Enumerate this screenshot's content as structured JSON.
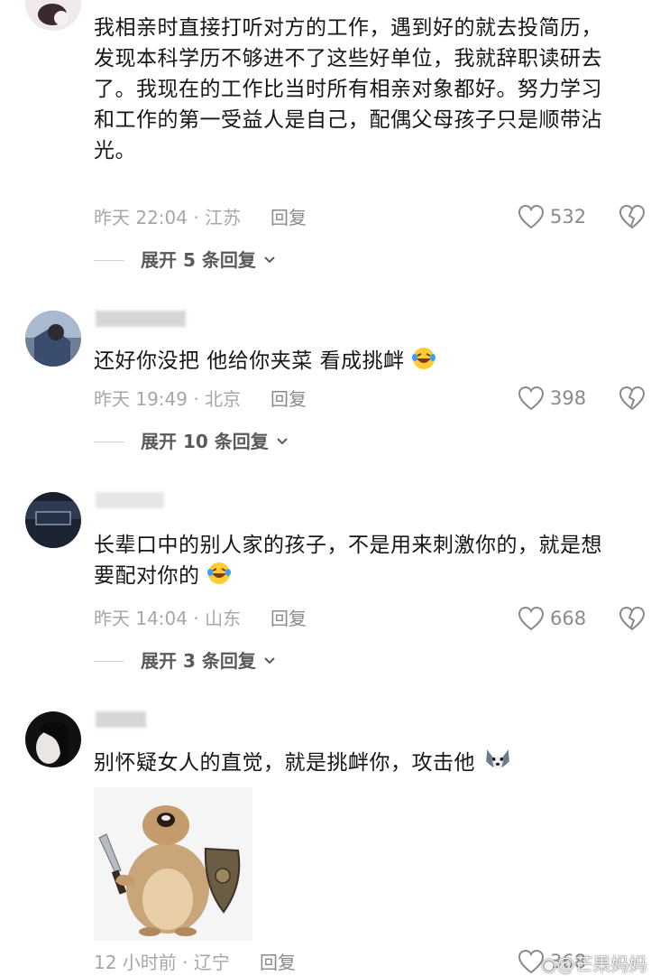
{
  "comments": [
    {
      "text": "我相亲时直接打听对方的工作，遇到好的就去投简历，发现本科学历不够进不了这些好单位，我就辞职读研去了。我现在的工作比当时所有相亲对象都好。努力学习和工作的第一受益人是自己，配偶父母孩子只是顺带沾光。",
      "lines": [
        "我相亲时直接打听对方的工作，遇到好的就去投简历，",
        "发现本科学历不够进不了这些好单位，我就辞职读研去",
        "了。我现在的工作比当时所有相亲对象都好。努力学习",
        "和工作的第一受益人是自己，配偶父母孩子只是顺带沾",
        "光。"
      ],
      "time_location": "昨天 22:04 · 江苏",
      "reply_label": "回复",
      "likes": "532",
      "expand_label": "展开 5 条回复"
    },
    {
      "text": "还好你没把 他给你夹菜 看成挑衅",
      "emoji": "laugh-cry-emoji",
      "time_location": "昨天 19:49 · 北京",
      "reply_label": "回复",
      "likes": "398",
      "expand_label": "展开 10 条回复"
    },
    {
      "lines": [
        "长辈口中的别人家的孩子，不是用来刺激你的，就是想",
        "要配对你的"
      ],
      "emoji": "laugh-cry-emoji",
      "time_location": "昨天 14:04 · 山东",
      "reply_label": "回复",
      "likes": "668",
      "expand_label": "展开 3 条回复"
    },
    {
      "text": "别怀疑女人的直觉，就是挑衅你，攻击他",
      "emoji": "dog-emoji",
      "time_location": "12 小时前 · 辽宁",
      "reply_label": "回复",
      "likes": "368"
    }
  ],
  "watermark": "@芒果妈妈",
  "colors": {
    "text": "#161616",
    "meta": "#a7a7a7",
    "icon": "#8a8a8a"
  }
}
